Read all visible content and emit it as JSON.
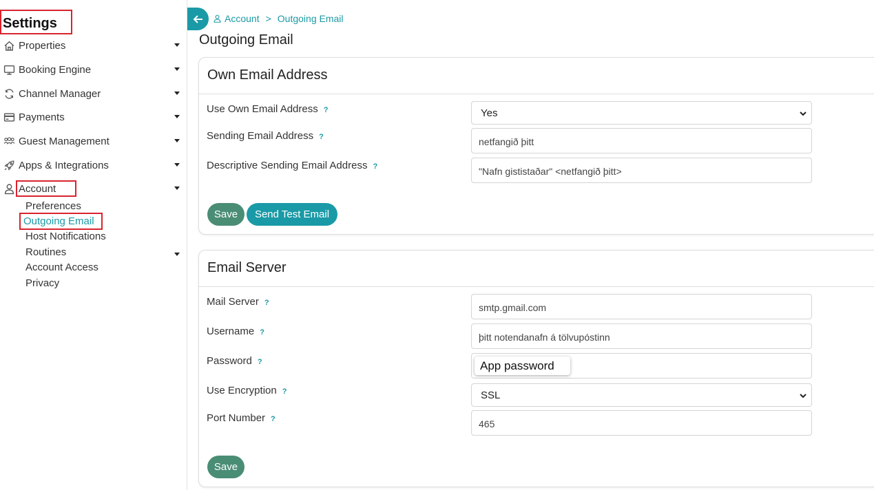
{
  "sidebar": {
    "title": "Settings",
    "items": [
      {
        "label": "Properties",
        "icon": "home-icon"
      },
      {
        "label": "Booking Engine",
        "icon": "monitor-icon"
      },
      {
        "label": "Channel Manager",
        "icon": "sync-icon"
      },
      {
        "label": "Payments",
        "icon": "credit-card-icon"
      },
      {
        "label": "Guest Management",
        "icon": "users-icon"
      },
      {
        "label": "Apps & Integrations",
        "icon": "rocket-icon"
      },
      {
        "label": "Account",
        "icon": "user-icon"
      }
    ],
    "account_sub": [
      "Preferences",
      "Outgoing Email",
      "Host Notifications",
      "Routines",
      "Account Access",
      "Privacy"
    ]
  },
  "breadcrumb": {
    "parent": "Account",
    "separator": ">",
    "current": "Outgoing Email"
  },
  "page_title": "Outgoing Email",
  "own_email": {
    "header": "Own Email Address",
    "use_own_label": "Use Own Email Address",
    "use_own_value": "Yes",
    "sending_label": "Sending Email Address",
    "sending_value": "netfangið þitt",
    "descriptive_label": "Descriptive Sending Email Address",
    "descriptive_value": "\"Nafn gististaðar\" <netfangið þitt>",
    "save_label": "Save",
    "test_label": "Send Test Email"
  },
  "email_server": {
    "header": "Email Server",
    "mail_server_label": "Mail Server",
    "mail_server_value": "smtp.gmail.com",
    "username_label": "Username",
    "username_value": "þitt notendanafn á tölvupóstinn",
    "password_label": "Password",
    "password_tooltip": "App password",
    "encryption_label": "Use Encryption",
    "encryption_value": "SSL",
    "port_label": "Port Number",
    "port_value": "465",
    "save_label": "Save"
  },
  "help_mark": "?",
  "colors": {
    "accent": "#1a9aa6",
    "save_green": "#4a8d75",
    "highlight_red": "#d9232d"
  }
}
